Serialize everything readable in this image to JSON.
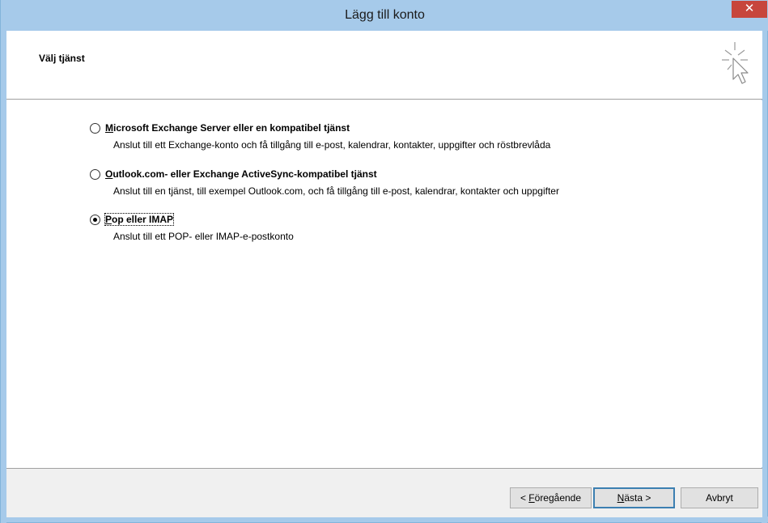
{
  "window": {
    "title": "Lägg till konto",
    "close_label": "✕"
  },
  "header": {
    "title": "Välj tjänst"
  },
  "options": [
    {
      "label_first": "M",
      "label_rest": "icrosoft Exchange Server eller en kompatibel tjänst",
      "description": "Anslut till ett Exchange-konto och få tillgång till e-post, kalendrar, kontakter, uppgifter och röstbrevlåda",
      "checked": false
    },
    {
      "label_first": "O",
      "label_rest": "utlook.com- eller Exchange ActiveSync-kompatibel tjänst",
      "description": "Anslut till en tjänst, till exempel Outlook.com, och få tillgång till e-post, kalendrar, kontakter och uppgifter",
      "checked": false
    },
    {
      "label_first": "P",
      "label_rest": "op eller IMAP",
      "description": "Anslut till ett POP- eller IMAP-e-postkonto",
      "checked": true
    }
  ],
  "footer": {
    "back_prefix": "< ",
    "back_accel": "F",
    "back_rest": "öregående",
    "next_accel": "N",
    "next_rest": "ästa >",
    "cancel_label": "Avbryt"
  }
}
